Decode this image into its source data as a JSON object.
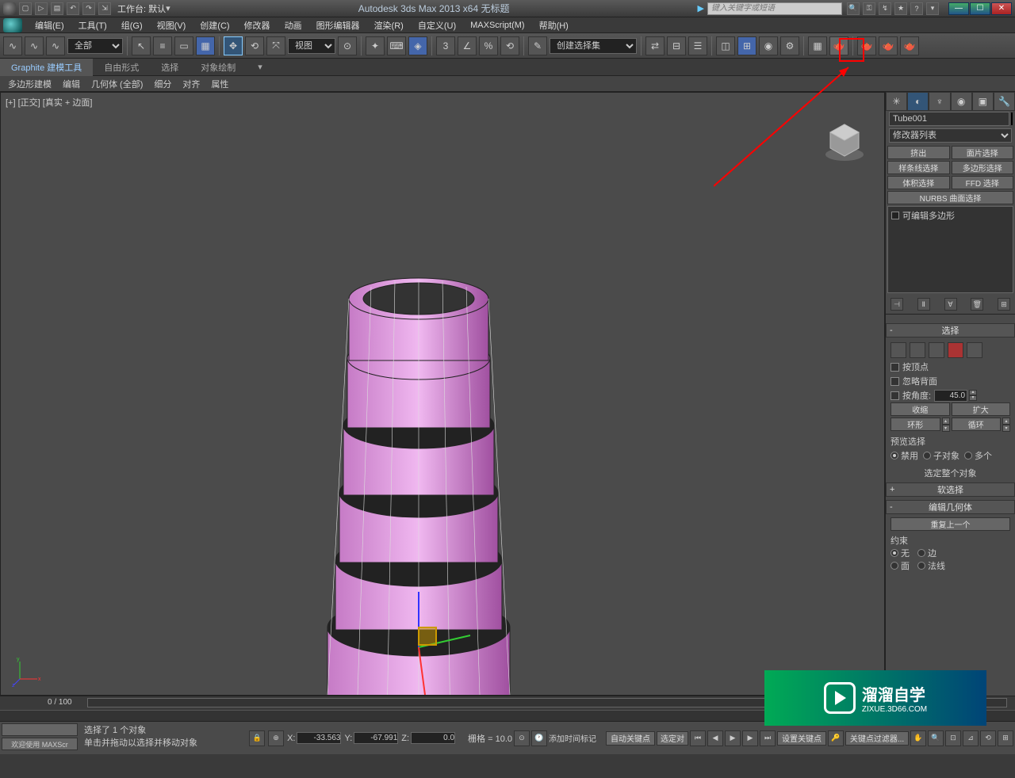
{
  "titlebar": {
    "workspace": "工作台: 默认",
    "title": "Autodesk 3ds Max  2013 x64   无标题",
    "search_placeholder": "键入关键字或短语"
  },
  "menubar": {
    "items": [
      "编辑(E)",
      "工具(T)",
      "组(G)",
      "视图(V)",
      "创建(C)",
      "修改器",
      "动画",
      "图形编辑器",
      "渲染(R)",
      "自定义(U)",
      "MAXScript(M)",
      "帮助(H)"
    ]
  },
  "toolbar": {
    "sel_filter": "全部",
    "view_label": "视图",
    "named_sel": "创建选择集"
  },
  "ribbon": {
    "tabs": [
      "Graphite 建模工具",
      "自由形式",
      "选择",
      "对象绘制"
    ],
    "sub": [
      "多边形建模",
      "编辑",
      "几何体 (全部)",
      "细分",
      "对齐",
      "属性"
    ]
  },
  "viewport": {
    "label": "[+] [正交] [真实 + 边面]"
  },
  "cmdpanel": {
    "obj_name": "Tube001",
    "modlist_label": "修改器列表",
    "preset_btns": [
      [
        "挤出",
        "面片选择"
      ],
      [
        "样条线选择",
        "多边形选择"
      ],
      [
        "体积选择",
        "FFD 选择"
      ]
    ],
    "nurbs": "NURBS 曲面选择",
    "stack_item": "可编辑多边形",
    "sel_rollout": "选择",
    "by_vertex": "按顶点",
    "ignore_bf": "忽略背面",
    "by_angle": "按角度:",
    "angle_val": "45.0",
    "shrink": "收缩",
    "grow": "扩大",
    "ring": "环形",
    "loop": "循环",
    "preview": "预览选择",
    "prev_off": "禁用",
    "prev_sub": "子对象",
    "prev_multi": "多个",
    "sel_whole": "选定整个对象",
    "soft_rollout": "软选择",
    "editgeo_rollout": "编辑几何体",
    "repeat": "重复上一个",
    "constraint": "约束",
    "c_none": "无",
    "c_edge": "边",
    "c_face": "面",
    "c_normal": "法线"
  },
  "timeline": {
    "range": "0 / 100"
  },
  "status": {
    "sel_info": "选择了 1 个对象",
    "hint": "单击并拖动以选择并移动对象",
    "x": "-33.563",
    "y": "-67.991",
    "z": "0.0",
    "grid": "栅格 = 10.0",
    "autokey": "自动关键点",
    "setkey": "设置关键点",
    "keyfilter": "关键点过滤器...",
    "timetag": "添加时间标记",
    "selset": "选定对",
    "welcome": "欢迎使用  MAXScr"
  },
  "watermark": {
    "text": "溜溜自学",
    "sub": "ZIXUE.3D66.COM"
  }
}
